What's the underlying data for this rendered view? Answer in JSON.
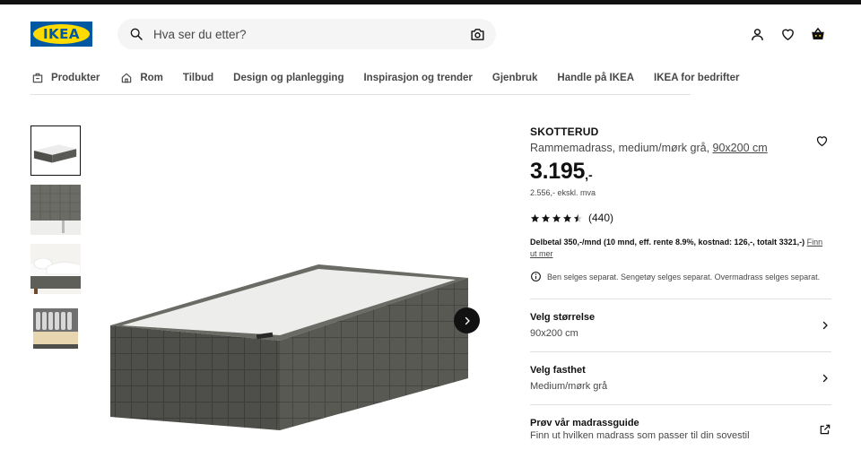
{
  "header": {
    "logo_text": "IKEA",
    "search_placeholder": "Hva ser du etter?",
    "icons": [
      "search-icon",
      "camera-icon",
      "account-icon",
      "heart-icon",
      "basket-icon"
    ]
  },
  "nav": {
    "items": [
      {
        "label": "Produkter",
        "icon": "products-icon"
      },
      {
        "label": "Rom",
        "icon": "home-icon"
      },
      {
        "label": "Tilbud"
      },
      {
        "label": "Design og planlegging"
      },
      {
        "label": "Inspirasjon og trender"
      },
      {
        "label": "Gjenbruk"
      },
      {
        "label": "Handle på IKEA"
      },
      {
        "label": "IKEA for bedrifter"
      }
    ]
  },
  "gallery": {
    "selected_index": 0,
    "thumbnail_count": 4
  },
  "product": {
    "name": "SKOTTERUD",
    "description": "Rammemadrass, medium/mørk grå,",
    "size_link": "90x200 cm",
    "price_main": "3.195",
    "price_suffix": ",-",
    "price_ex_vat": "2.556,- ekskl. mva",
    "rating": 4.5,
    "rating_count": "(440)",
    "finance_text": "Delbetal 350,-/mnd (10 mnd, eff. rente 8.9%, kostnad: 126,-, totalt 3321,-)",
    "finance_link": "Finn ut mer",
    "info_text": "Ben selges separat. Sengetøy selges separat. Overmadrass selges separat."
  },
  "selectors": [
    {
      "title": "Velg størrelse",
      "value": "90x200 cm"
    },
    {
      "title": "Velg fasthet",
      "value": "Medium/mørk grå"
    },
    {
      "title": "Prøv vår madrassguide",
      "value": "Finn ut hvilken madrass som passer til din sovestil"
    }
  ],
  "colors": {
    "brand_blue": "#0058a3",
    "brand_yellow": "#ffdb00",
    "text_primary": "#111111",
    "text_secondary": "#484848",
    "divider": "#dfdfdf",
    "mattress_base": "#4e4f4a"
  }
}
